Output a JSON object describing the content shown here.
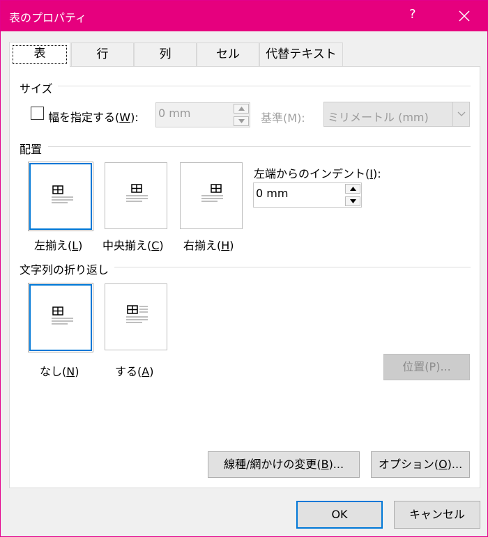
{
  "window": {
    "title": "表のプロパティ",
    "help": "?"
  },
  "tabs": [
    {
      "label": "表",
      "active": true
    },
    {
      "label": "行"
    },
    {
      "label": "列"
    },
    {
      "label": "セル"
    },
    {
      "label": "代替テキスト"
    }
  ],
  "size_group": {
    "label": "サイズ",
    "width_checkbox": {
      "pre": "幅を指定する(",
      "key": "W",
      "post": "):",
      "checked": false
    },
    "width_value": "0 mm",
    "basis": {
      "pre": "基準(",
      "key": "M",
      "post": "):"
    },
    "basis_value": "ミリメートル (mm)"
  },
  "align_group": {
    "label": "配置",
    "options": [
      {
        "pre": "左揃え(",
        "key": "L",
        "post": ")",
        "selected": true
      },
      {
        "pre": "中央揃え(",
        "key": "C",
        "post": ")"
      },
      {
        "pre": "右揃え(",
        "key": "H",
        "post": ")"
      }
    ],
    "indent_label": {
      "pre": "左端からのインデント(",
      "key": "I",
      "post": "):"
    },
    "indent_value": "0 mm"
  },
  "wrap_group": {
    "label": "文字列の折り返し",
    "options": [
      {
        "pre": "なし(",
        "key": "N",
        "post": ")",
        "selected": true
      },
      {
        "pre": "する(",
        "key": "A",
        "post": ")"
      }
    ],
    "position_button": {
      "pre": "位置(",
      "key": "P",
      "post": ")..."
    }
  },
  "bottom_buttons": {
    "borders": {
      "pre": "線種/網かけの変更(",
      "key": "B",
      "post": ")..."
    },
    "options": {
      "pre": "オプション(",
      "key": "O",
      "post": ")..."
    }
  },
  "footer": {
    "ok": "OK",
    "cancel": "キャンセル"
  }
}
